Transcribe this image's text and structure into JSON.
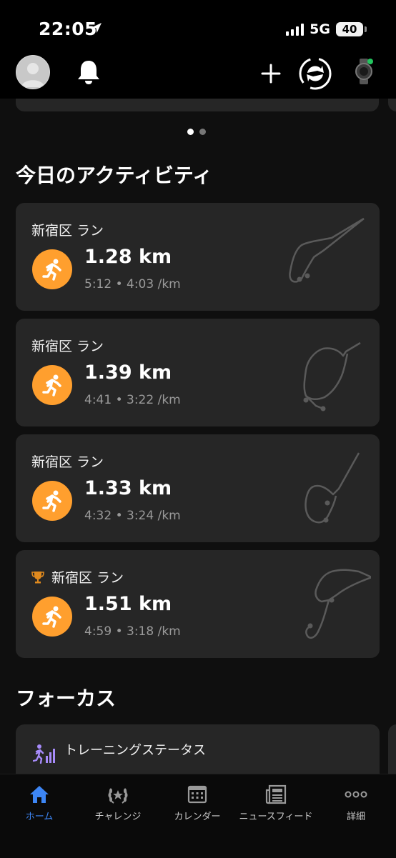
{
  "status_bar": {
    "time": "22:05",
    "network": "5G",
    "battery": "40"
  },
  "header": {
    "icons": {
      "profile": "avatar",
      "notifications": "bell-icon",
      "add": "plus-icon",
      "sync": "sync-icon",
      "device": "watch-icon"
    },
    "device_status_color": "#22c55e"
  },
  "carousel": {
    "page_count": 2,
    "active_page": 1
  },
  "today_section": {
    "title": "今日のアクティビティ"
  },
  "activities": [
    {
      "title": "新宿区 ラン",
      "distance": "1.28 km",
      "meta": "5:12 • 4:03 /km",
      "trophy": false
    },
    {
      "title": "新宿区 ラン",
      "distance": "1.39 km",
      "meta": "4:41 • 3:22 /km",
      "trophy": false
    },
    {
      "title": "新宿区 ラン",
      "distance": "1.33 km",
      "meta": "4:32 • 3:24 /km",
      "trophy": false
    },
    {
      "title": "新宿区 ラン",
      "distance": "1.51 km",
      "meta": "4:59 • 3:18 /km",
      "trophy": true
    }
  ],
  "focus_section": {
    "title": "フォーカス",
    "card_label": "トレーニングステータス"
  },
  "tabs": [
    {
      "label": "ホーム",
      "icon": "home-icon",
      "active": true
    },
    {
      "label": "チャレンジ",
      "icon": "laurel-icon",
      "active": false
    },
    {
      "label": "カレンダー",
      "icon": "calendar-icon",
      "active": false
    },
    {
      "label": "ニュースフィード",
      "icon": "newspaper-icon",
      "active": false
    },
    {
      "label": "詳細",
      "icon": "more-icon",
      "active": false
    }
  ],
  "colors": {
    "accent": "#3d86f5",
    "run_badge": "#ff9f2e",
    "trophy": "#e08a1e",
    "card": "#262626",
    "background": "#0f0f0f"
  }
}
